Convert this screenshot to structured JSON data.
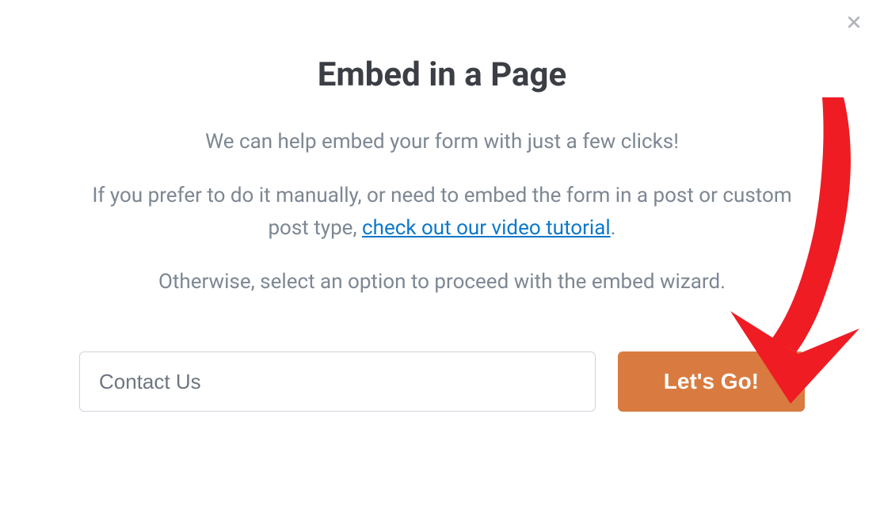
{
  "modal": {
    "title": "Embed in a Page",
    "intro": "We can help embed your form with just a few clicks!",
    "manual_prefix": "If you prefer to do it manually, or need to embed the form in a post or custom post type, ",
    "link_text": "check out our video tutorial",
    "manual_suffix": ".",
    "otherwise": "Otherwise, select an option to proceed with the embed wizard.",
    "input_value": "Contact Us",
    "button_label": "Let's Go!"
  },
  "colors": {
    "accent": "#d97b40",
    "link": "#0d78c9",
    "arrow": "#ef1c24"
  }
}
